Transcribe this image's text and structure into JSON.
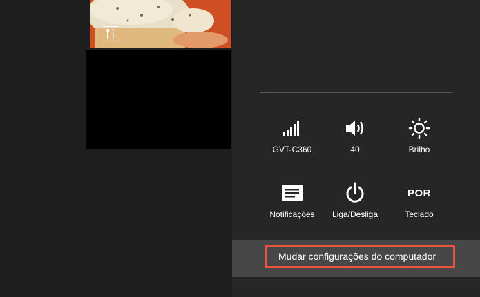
{
  "start_screen": {
    "food_tile_icon": "fork-knife-icon",
    "colors": {
      "background": "#1e1e1e",
      "food_tile": "#d4552a",
      "black_tile": "#000000"
    }
  },
  "settings_charm": {
    "tiles": [
      {
        "icon": "signal-bars-icon",
        "label": "GVT-C360"
      },
      {
        "icon": "speaker-icon",
        "label": "40"
      },
      {
        "icon": "sun-brightness-icon",
        "label": "Brilho"
      },
      {
        "icon": "notifications-icon",
        "label": "Notificações"
      },
      {
        "icon": "power-icon",
        "label": "Liga/Desliga"
      },
      {
        "icon": "keyboard-language",
        "label": "Teclado",
        "text": "POR"
      }
    ],
    "change_pc_settings_label": "Mudar configurações do computador",
    "colors": {
      "panel": "#262626",
      "bar": "#474747",
      "highlight": "#e8543f"
    }
  }
}
